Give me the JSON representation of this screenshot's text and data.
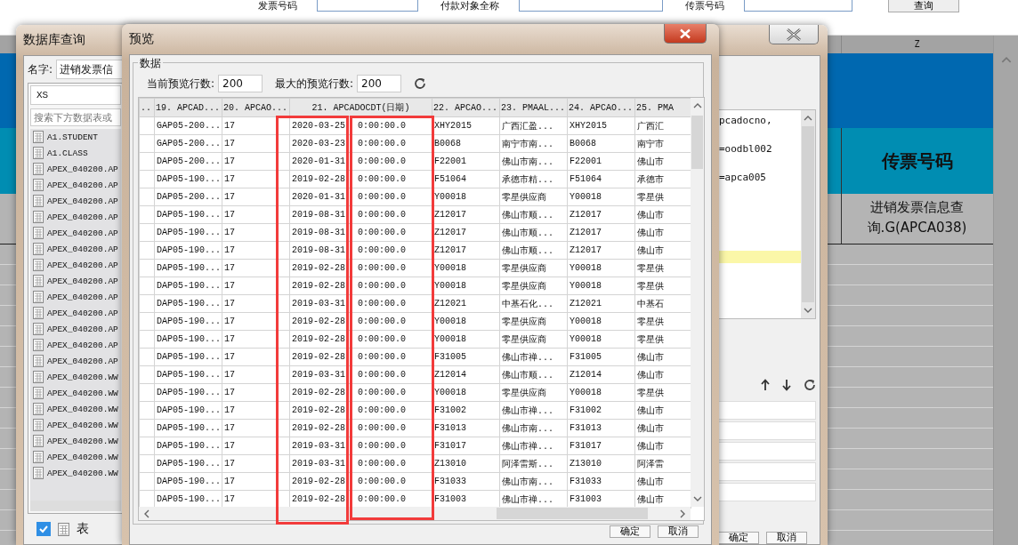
{
  "background_form": {
    "fields": [
      {
        "label": "发票号码"
      },
      {
        "label": "付款对象全称"
      },
      {
        "label": "传票号码"
      }
    ],
    "button": "查询"
  },
  "sheet": {
    "column_header": "Z",
    "header_cell": "传票号码",
    "data_cell": "进销发票信息查询.G(APCA038)"
  },
  "db_query_window": {
    "title": "数据库查询",
    "name_label": "名字:",
    "name_value": "进销发票信",
    "filter_value": "XS",
    "search_placeholder": "搜索下方数据表或",
    "tables": [
      {
        "name": "A1.STUDENT"
      },
      {
        "name": "A1.CLASS"
      },
      {
        "name": "APEX_040200.AP"
      },
      {
        "name": "APEX_040200.AP"
      },
      {
        "name": "APEX_040200.AP"
      },
      {
        "name": "APEX_040200.AP"
      },
      {
        "name": "APEX_040200.AP"
      },
      {
        "name": "APEX_040200.AP"
      },
      {
        "name": "APEX_040200.AP"
      },
      {
        "name": "APEX_040200.AP"
      },
      {
        "name": "APEX_040200.AP"
      },
      {
        "name": "APEX_040200.AP"
      },
      {
        "name": "APEX_040200.AP"
      },
      {
        "name": "APEX_040200.AP"
      },
      {
        "name": "APEX_040200.AP"
      },
      {
        "name": "APEX_040200.WW"
      },
      {
        "name": "APEX_040200.WW"
      },
      {
        "name": "APEX_040200.WW"
      },
      {
        "name": "APEX_040200.WW"
      },
      {
        "name": "APEX_040200.WW"
      },
      {
        "name": "APEX_040200.WW"
      },
      {
        "name": "APEX_040200.WW"
      }
    ],
    "show_tables": {
      "checked": true,
      "label": "表"
    },
    "sql_lines": [
      "pcadocno,",
      "=oodbl002",
      "=apca005"
    ],
    "buttons": [
      "确定",
      "取消"
    ]
  },
  "preview_window": {
    "title": "预览",
    "group_label": "数据",
    "current_rows_label": "当前预览行数:",
    "current_rows": "200",
    "max_rows_label": "最大的预览行数:",
    "max_rows": "200",
    "table": {
      "row_header_column": "..",
      "columns": [
        "19. APCAD...",
        "20. APCAO...",
        "21. APCADOCDT(日期)",
        "22. APCAO...",
        "23. PMAAL...",
        "24. APCAO...",
        "25. PMA"
      ],
      "rows": [
        {
          "cells": [
            "GAP05-200...",
            "17",
            "2020-03-25 0:00:00.0",
            "XHY2015",
            "广西汇盈...",
            "XHY2015",
            "广西汇"
          ]
        },
        {
          "cells": [
            "GAP05-200...",
            "17",
            "2020-03-23 0:00:00.0",
            "B0068",
            "南宁市南...",
            "B0068",
            "南宁市"
          ]
        },
        {
          "cells": [
            "DAP05-200...",
            "17",
            "2020-01-31 0:00:00.0",
            "F22001",
            "佛山市南...",
            "F22001",
            "佛山市"
          ]
        },
        {
          "cells": [
            "DAP05-190...",
            "17",
            "2019-02-28 0:00:00.0",
            "F51064",
            "承德市精...",
            "F51064",
            "承德市"
          ]
        },
        {
          "cells": [
            "DAP05-200...",
            "17",
            "2020-01-31 0:00:00.0",
            "Y00018",
            "零星供应商",
            "Y00018",
            "零星供"
          ]
        },
        {
          "cells": [
            "DAP05-190...",
            "17",
            "2019-08-31 0:00:00.0",
            "Z12017",
            "佛山市顺...",
            "Z12017",
            "佛山市"
          ]
        },
        {
          "cells": [
            "DAP05-190...",
            "17",
            "2019-08-31 0:00:00.0",
            "Z12017",
            "佛山市顺...",
            "Z12017",
            "佛山市"
          ]
        },
        {
          "cells": [
            "DAP05-190...",
            "17",
            "2019-08-31 0:00:00.0",
            "Z12017",
            "佛山市顺...",
            "Z12017",
            "佛山市"
          ]
        },
        {
          "cells": [
            "DAP05-190...",
            "17",
            "2019-02-28 0:00:00.0",
            "Y00018",
            "零星供应商",
            "Y00018",
            "零星供"
          ]
        },
        {
          "cells": [
            "DAP05-190...",
            "17",
            "2019-02-28 0:00:00.0",
            "Y00018",
            "零星供应商",
            "Y00018",
            "零星供"
          ]
        },
        {
          "cells": [
            "DAP05-190...",
            "17",
            "2019-03-31 0:00:00.0",
            "Z12021",
            "中基石化...",
            "Z12021",
            "中基石"
          ]
        },
        {
          "cells": [
            "DAP05-190...",
            "17",
            "2019-02-28 0:00:00.0",
            "Y00018",
            "零星供应商",
            "Y00018",
            "零星供"
          ]
        },
        {
          "cells": [
            "DAP05-190...",
            "17",
            "2019-02-28 0:00:00.0",
            "Y00018",
            "零星供应商",
            "Y00018",
            "零星供"
          ]
        },
        {
          "cells": [
            "DAP05-190...",
            "17",
            "2019-02-28 0:00:00.0",
            "F31005",
            "佛山市禅...",
            "F31005",
            "佛山市"
          ]
        },
        {
          "cells": [
            "DAP05-190...",
            "17",
            "2019-03-31 0:00:00.0",
            "Z12014",
            "佛山市顺...",
            "Z12014",
            "佛山市"
          ]
        },
        {
          "cells": [
            "DAP05-190...",
            "17",
            "2019-02-28 0:00:00.0",
            "Y00018",
            "零星供应商",
            "Y00018",
            "零星供"
          ]
        },
        {
          "cells": [
            "DAP05-190...",
            "17",
            "2019-02-28 0:00:00.0",
            "F31002",
            "佛山市禅...",
            "F31002",
            "佛山市"
          ]
        },
        {
          "cells": [
            "DAP05-190...",
            "17",
            "2019-02-28 0:00:00.0",
            "F31013",
            "佛山市南...",
            "F31013",
            "佛山市"
          ]
        },
        {
          "cells": [
            "DAP05-190...",
            "17",
            "2019-03-31 0:00:00.0",
            "F31017",
            "佛山市禅...",
            "F31017",
            "佛山市"
          ]
        },
        {
          "cells": [
            "DAP05-190...",
            "17",
            "2019-03-31 0:00:00.0",
            "Z13010",
            "阿泽雷斯...",
            "Z13010",
            "阿泽雷"
          ]
        },
        {
          "cells": [
            "DAP05-190...",
            "17",
            "2019-02-28 0:00:00.0",
            "F31033",
            "佛山市南...",
            "F31033",
            "佛山市"
          ]
        },
        {
          "cells": [
            "DAP05-190...",
            "17",
            "2019-02-28 0:00:00.0",
            "F31003",
            "佛山市禅...",
            "F31003",
            "佛山市"
          ]
        }
      ]
    },
    "buttons": [
      "确定",
      "取消"
    ]
  }
}
